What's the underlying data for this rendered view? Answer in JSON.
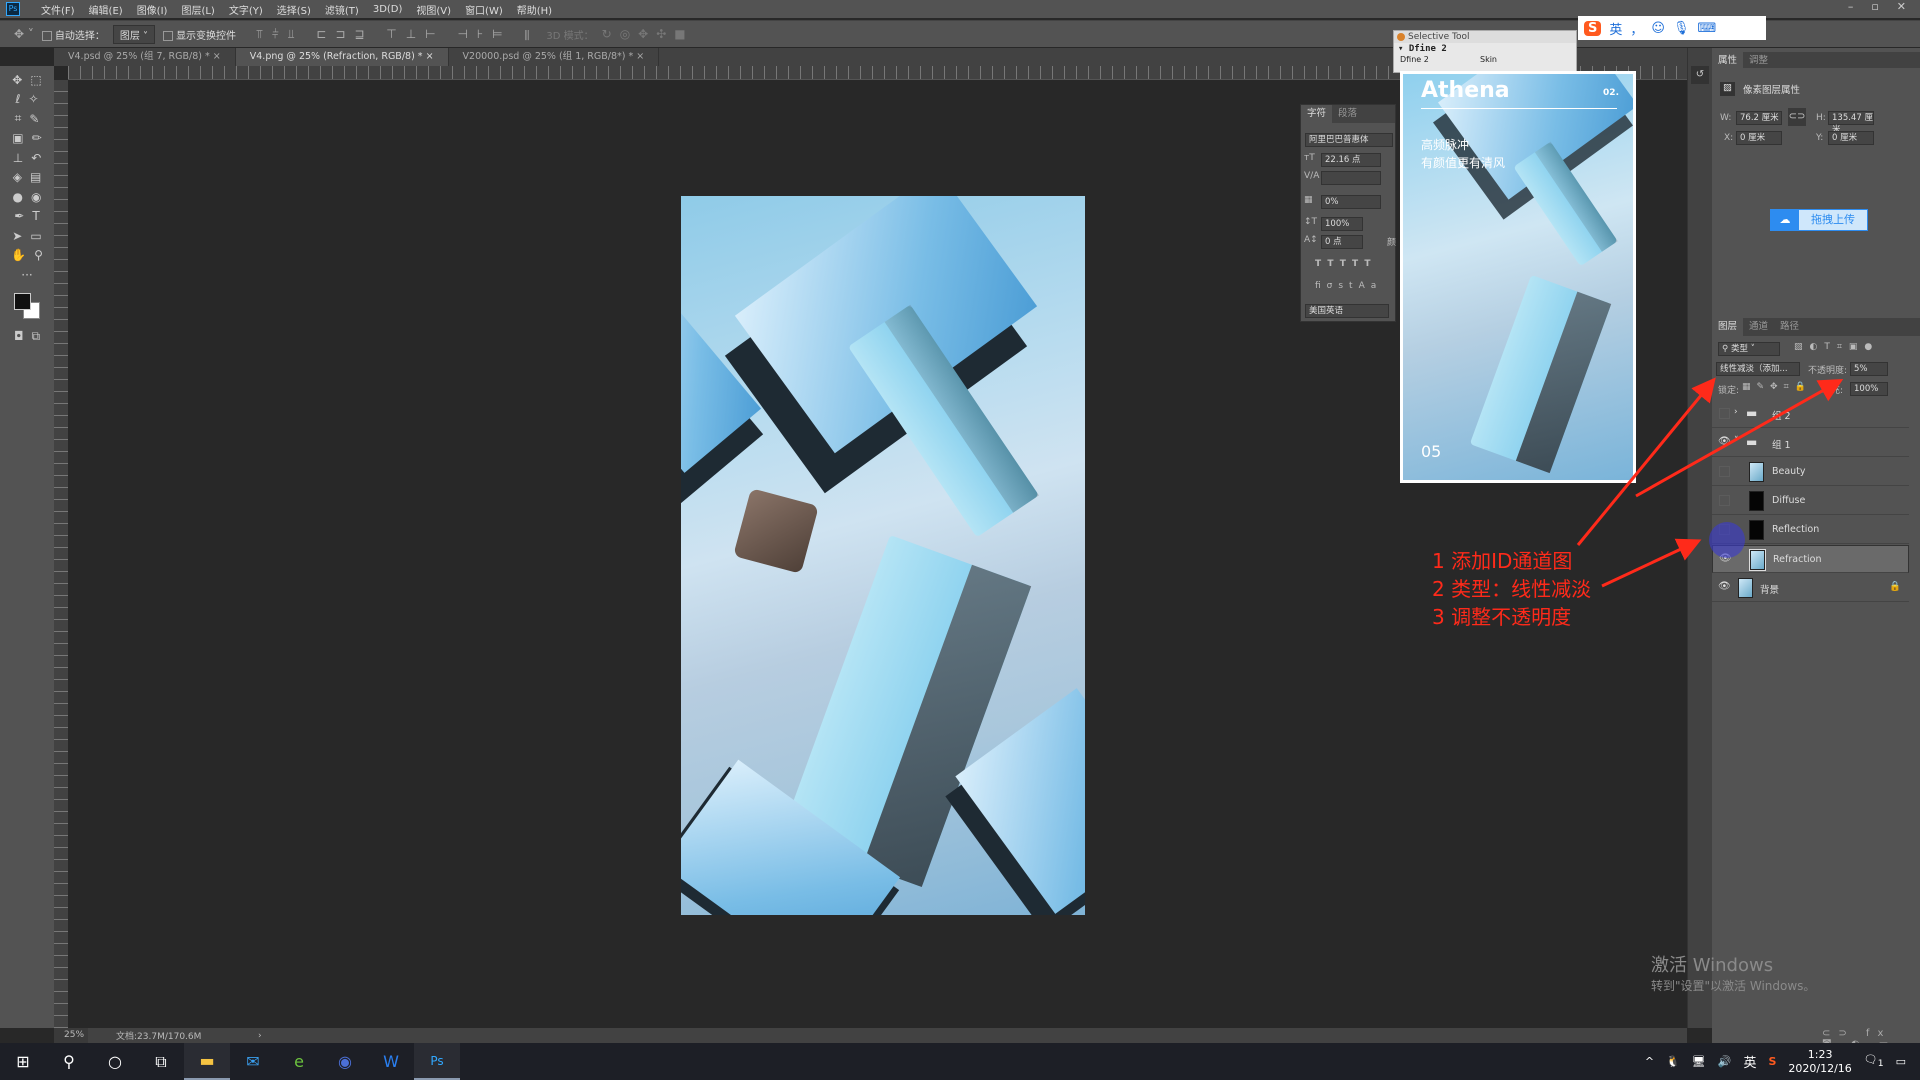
{
  "app": {
    "logo": "Ps",
    "menu": [
      "文件(F)",
      "编辑(E)",
      "图像(I)",
      "图层(L)",
      "文字(Y)",
      "选择(S)",
      "滤镜(T)",
      "3D(D)",
      "视图(V)",
      "窗口(W)",
      "帮助(H)"
    ],
    "window_controls": [
      "–",
      "▫",
      "✕"
    ]
  },
  "options_bar": {
    "auto_select_label": "自动选择：",
    "auto_select_value": "图层",
    "show_transform_label": "显示变换控件",
    "mode_3d_label": "3D 模式："
  },
  "tabs": [
    {
      "label": "V4.psd @ 25% (组 7, RGB/8) *",
      "close": "×",
      "active": false
    },
    {
      "label": "V4.png @ 25% (Refraction, RGB/8) *",
      "close": "×",
      "active": true
    },
    {
      "label": "V20000.psd @ 25% (组 1, RGB/8*) *",
      "close": "×",
      "active": false
    }
  ],
  "status": {
    "zoom": "25%",
    "doc": "文档:23.7M/170.6M",
    "arrow": "›"
  },
  "character_panel": {
    "tabs": [
      "字符",
      "段落"
    ],
    "font": "阿里巴巴普惠体",
    "size": "22.16 点",
    "tracking": "0%",
    "vscale": "100%",
    "baseline": "0 点",
    "language": "美国英语",
    "color_label": "颜"
  },
  "selective_tool": {
    "title": "Selective Tool",
    "item": "Dfine 2",
    "cols": [
      "Dfine 2",
      "Skin"
    ]
  },
  "preview": {
    "title": "Athena",
    "number": "02.",
    "headline1": "高频脉冲",
    "headline2": "有颜值更有清风",
    "page": "05"
  },
  "ime": {
    "label": "英",
    "extra": "，"
  },
  "properties": {
    "tabs": [
      "属性",
      "调整"
    ],
    "title": "像素图层属性",
    "w_label": "W:",
    "w": "76.2 厘米",
    "h_label": "H:",
    "h": "135.47 厘米",
    "x_label": "X:",
    "x": "0 厘米",
    "y_label": "Y:",
    "y": "0 厘米",
    "upload": "拖拽上传"
  },
  "layers_panel": {
    "tabs": [
      "图层",
      "通道",
      "路径"
    ],
    "filter": "类型",
    "blend_mode": "线性减淡（添加...",
    "opacity_label": "不透明度:",
    "opacity": "5%",
    "lock_label": "锁定:",
    "fill_label": "填充:",
    "fill": "100%",
    "layers": [
      {
        "name": "组 2",
        "type": "group",
        "visible": false,
        "expanded": false
      },
      {
        "name": "组 1",
        "type": "group",
        "visible": true,
        "expanded": true
      },
      {
        "name": "Beauty",
        "type": "pixel",
        "visible": false
      },
      {
        "name": "Diffuse",
        "type": "pixel",
        "visible": false
      },
      {
        "name": "Reflection",
        "type": "pixel",
        "visible": false
      },
      {
        "name": "Refraction",
        "type": "pixel",
        "visible": true,
        "selected": true
      },
      {
        "name": "背景",
        "type": "pixel",
        "visible": true,
        "locked": true
      }
    ]
  },
  "annotations": [
    "1 添加ID通道图",
    "2 类型：线性减淡",
    "3 调整不透明度"
  ],
  "annotation_color": "#ff2a1a",
  "watermark": {
    "line1": "激活 Windows",
    "line2": "转到\"设置\"以激活 Windows。"
  },
  "taskbar": {
    "clock_time": "1:23",
    "clock_date": "2020/12/16",
    "ime": "英",
    "notification_count": "1",
    "apps": [
      "file-explorer",
      "mail",
      "browser",
      "cinema4d",
      "wps",
      "photoshop"
    ]
  }
}
